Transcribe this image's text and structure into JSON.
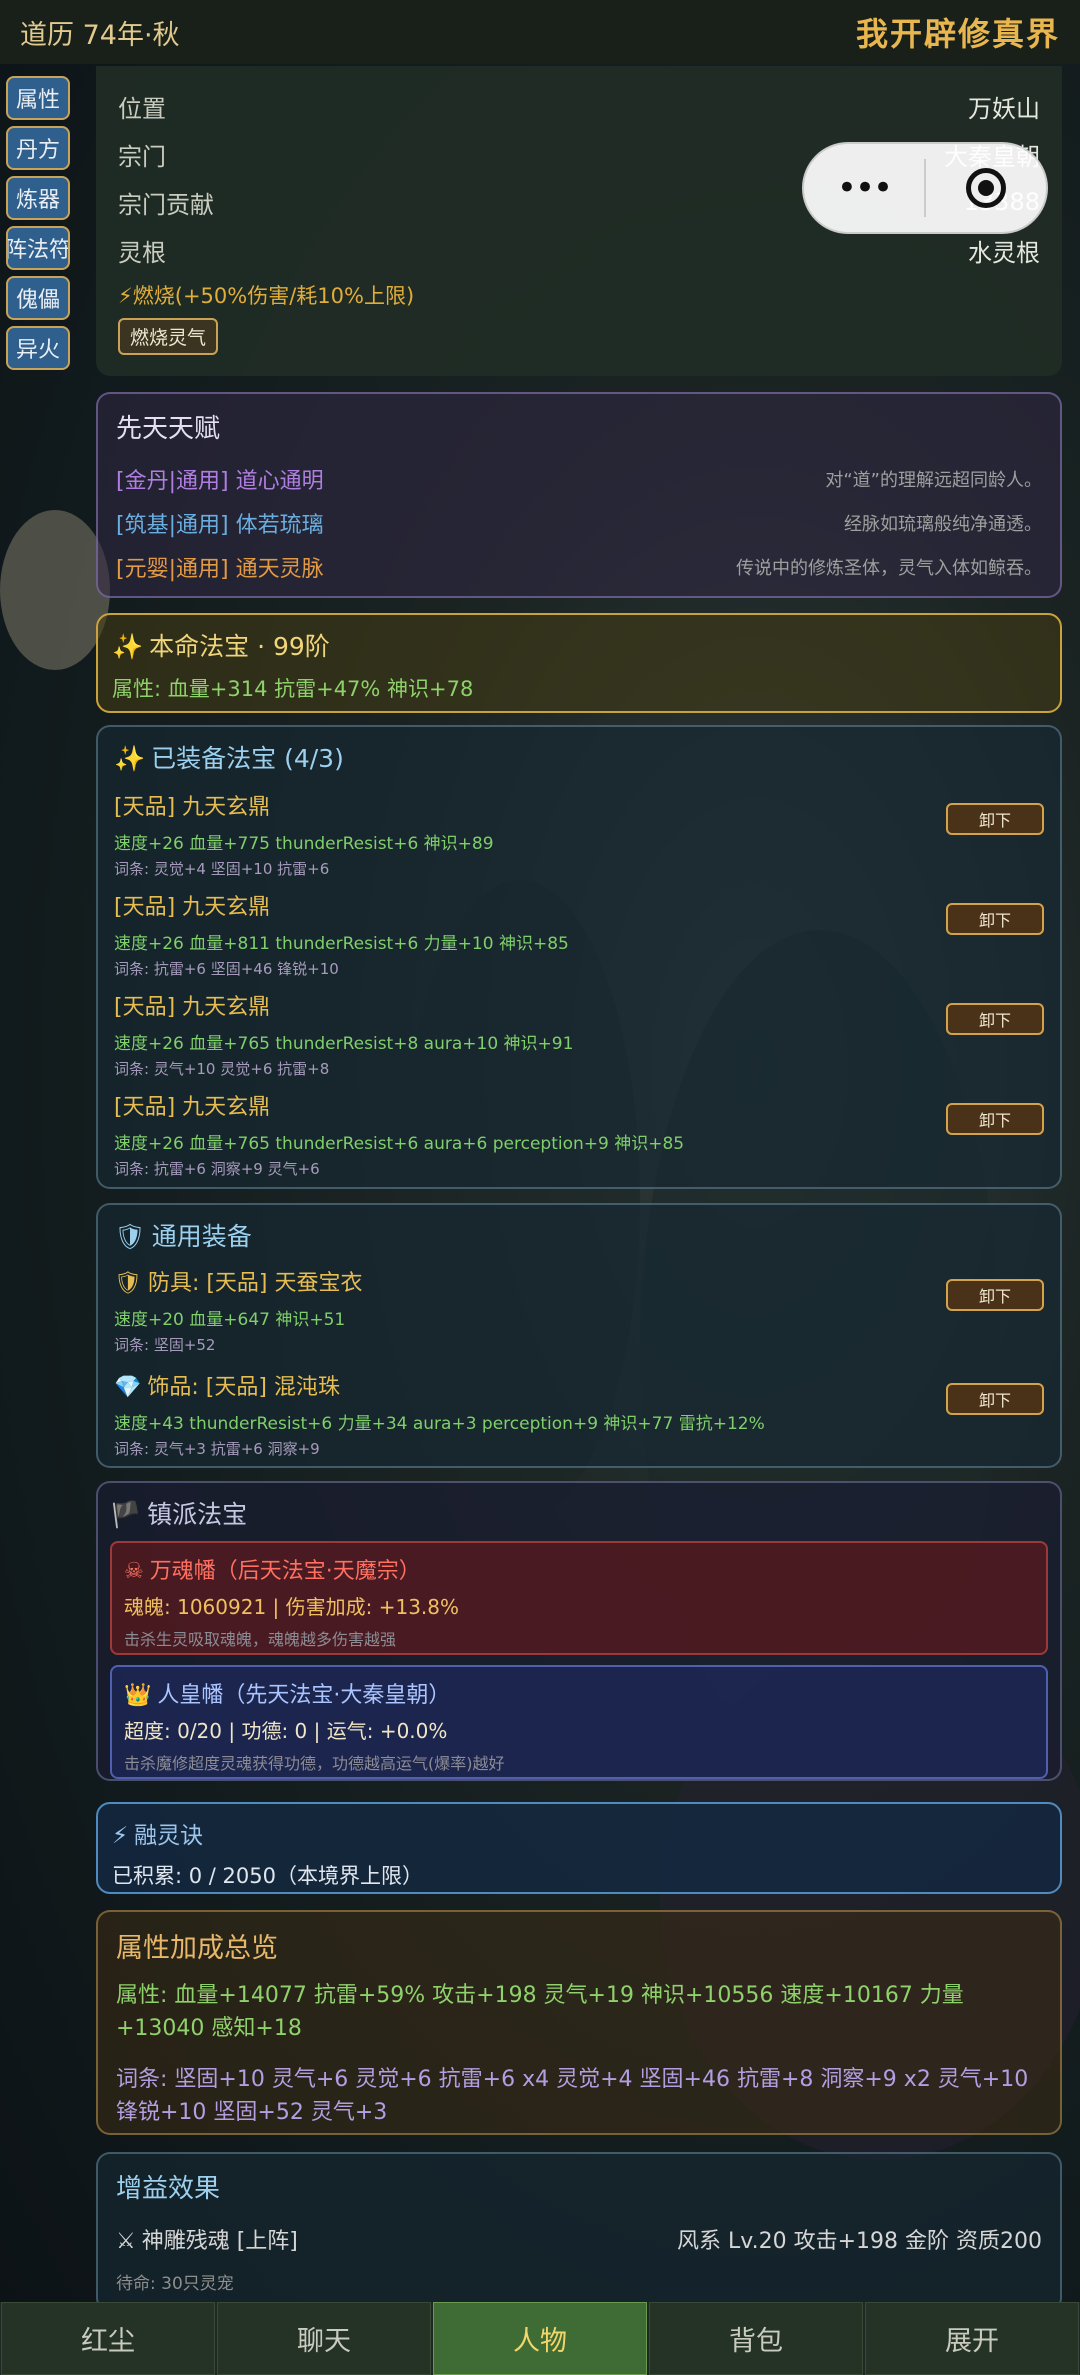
{
  "top": {
    "date": "道历 74年·秋",
    "title": "我开辟修真界"
  },
  "sidenav": [
    "属性",
    "丹方",
    "炼器",
    "阵法符",
    "傀儡",
    "异火"
  ],
  "info": {
    "rows": [
      {
        "k": "位置",
        "v": "万妖山"
      },
      {
        "k": "宗门",
        "v": "大秦皇朝"
      },
      {
        "k": "宗门贡献",
        "v": "13388"
      },
      {
        "k": "灵根",
        "v": "水灵根"
      }
    ],
    "burn_text": "⚡燃烧(+50%伤害/耗10%上限)",
    "burn_button": "燃烧灵气"
  },
  "talent": {
    "title": "先天天赋",
    "items": [
      {
        "name": "[金丹|通用] 道心通明",
        "desc": "对“道”的理解远超同龄人。",
        "color": "#b07ee0"
      },
      {
        "name": "[筑基|通用] 体若琉璃",
        "desc": "经脉如琉璃般纯净通透。",
        "color": "#6aaee0"
      },
      {
        "name": "[元婴|通用] 通天灵脉",
        "desc": "传说中的修炼圣体，灵气入体如鲸吞。",
        "color": "#e39a44"
      }
    ]
  },
  "natal": {
    "title": "本命法宝 · 99阶",
    "attr": "属性: 血量+314  抗雷+47%  神识+78"
  },
  "equipped": {
    "title": "已装备法宝 (4/3)",
    "unequip": "卸下",
    "items": [
      {
        "name": "[天品] 九天玄鼎",
        "stats": "速度+26  血量+775  thunderResist+6  神识+89",
        "affix": "词条: 灵觉+4 坚固+10 抗雷+6"
      },
      {
        "name": "[天品] 九天玄鼎",
        "stats": "速度+26  血量+811  thunderResist+6  力量+10  神识+85",
        "affix": "词条: 抗雷+6 坚固+46 锋锐+10"
      },
      {
        "name": "[天品] 九天玄鼎",
        "stats": "速度+26  血量+765  thunderResist+8  aura+10  神识+91",
        "affix": "词条: 灵气+10 灵觉+6 抗雷+8"
      },
      {
        "name": "[天品] 九天玄鼎",
        "stats": "速度+26  血量+765  thunderResist+6  aura+6  perception+9  神识+85",
        "affix": "词条: 抗雷+6 洞察+9 灵气+6"
      }
    ]
  },
  "general": {
    "title": "通用装备",
    "items": [
      {
        "name": "防具: [天品] 天蚕宝衣",
        "stats": "速度+20  血量+647  神识+51",
        "affix": "词条: 坚固+52",
        "icon": "🛡"
      },
      {
        "name": "饰品: [天品] 混沌珠",
        "stats": "速度+43  thunderResist+6  力量+34  aura+3  perception+9  神识+77  雷抗+12%",
        "affix": "词条: 灵气+3 抗雷+6 洞察+9",
        "icon": "💎"
      }
    ]
  },
  "sect": {
    "title": "镇派法宝",
    "cards": [
      {
        "title": "万魂幡（后天法宝·天魔宗）",
        "stat": "魂魄: 1060921 | 伤害加成: +13.8%",
        "desc": "击杀生灵吸取魂魄，魂魄越多伤害越强",
        "icon": "☠"
      },
      {
        "title": "人皇幡（先天法宝·大秦皇朝）",
        "stat": "超度: 0/20 | 功德: 0 | 运气: +0.0%",
        "desc": "击杀魔修超度灵魂获得功德，功德越高运气(爆率)越好",
        "icon": "👑"
      }
    ]
  },
  "fusion": {
    "title": "融灵诀",
    "stat": "已积累: 0 / 2050（本境界上限）"
  },
  "bonus": {
    "title": "属性加成总览",
    "attrs": "属性: 血量+14077  抗雷+59%  攻击+198  灵气+19  神识+10556  速度+10167  力量+13040  感知+18",
    "affixes": "词条: 坚固+10  灵气+6  灵觉+6  抗雷+6 x4  灵觉+4  坚固+46  抗雷+8  洞察+9 x2  灵气+10  锋锐+10  坚固+52  灵气+3"
  },
  "buff": {
    "title": "增益效果",
    "pet": "神雕残魂 [上阵]",
    "pet_info": "风系 Lv.20  攻击+198  金阶 资质200",
    "sub": "待命: 30只灵宠"
  },
  "bottomnav": [
    "红尘",
    "聊天",
    "人物",
    "背包",
    "展开"
  ],
  "active_tab": "人物"
}
